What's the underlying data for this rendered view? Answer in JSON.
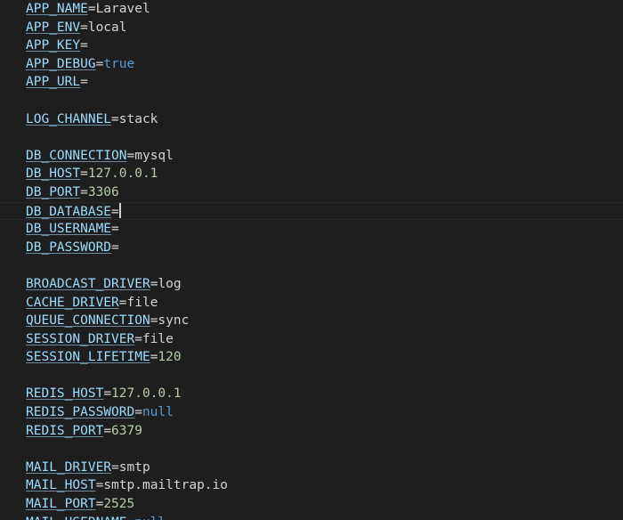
{
  "editor": {
    "colors": {
      "background": "#1e1e1e",
      "key": "#9cdcfe",
      "string": "#d4d4d4",
      "number": "#b5cea8",
      "keyword": "#569cd6"
    },
    "cursor_line": 11,
    "lines": [
      {
        "key": "APP_NAME",
        "value": "Laravel",
        "type": "str"
      },
      {
        "key": "APP_ENV",
        "value": "local",
        "type": "str"
      },
      {
        "key": "APP_KEY",
        "value": "",
        "type": "str"
      },
      {
        "key": "APP_DEBUG",
        "value": "true",
        "type": "kw"
      },
      {
        "key": "APP_URL",
        "value": "",
        "type": "str"
      },
      {
        "blank": true
      },
      {
        "key": "LOG_CHANNEL",
        "value": "stack",
        "type": "str"
      },
      {
        "blank": true
      },
      {
        "key": "DB_CONNECTION",
        "value": "mysql",
        "type": "str"
      },
      {
        "key": "DB_HOST",
        "value": "127.0.0.1",
        "type": "num"
      },
      {
        "key": "DB_PORT",
        "value": "3306",
        "type": "num"
      },
      {
        "key": "DB_DATABASE",
        "value": "",
        "type": "str"
      },
      {
        "key": "DB_USERNAME",
        "value": "",
        "type": "str"
      },
      {
        "key": "DB_PASSWORD",
        "value": "",
        "type": "str"
      },
      {
        "blank": true
      },
      {
        "key": "BROADCAST_DRIVER",
        "value": "log",
        "type": "str"
      },
      {
        "key": "CACHE_DRIVER",
        "value": "file",
        "type": "str"
      },
      {
        "key": "QUEUE_CONNECTION",
        "value": "sync",
        "type": "str"
      },
      {
        "key": "SESSION_DRIVER",
        "value": "file",
        "type": "str"
      },
      {
        "key": "SESSION_LIFETIME",
        "value": "120",
        "type": "num"
      },
      {
        "blank": true
      },
      {
        "key": "REDIS_HOST",
        "value": "127.0.0.1",
        "type": "num"
      },
      {
        "key": "REDIS_PASSWORD",
        "value": "null",
        "type": "kw"
      },
      {
        "key": "REDIS_PORT",
        "value": "6379",
        "type": "num"
      },
      {
        "blank": true
      },
      {
        "key": "MAIL_DRIVER",
        "value": "smtp",
        "type": "str"
      },
      {
        "key": "MAIL_HOST",
        "value": "smtp.mailtrap.io",
        "type": "str"
      },
      {
        "key": "MAIL_PORT",
        "value": "2525",
        "type": "num"
      },
      {
        "key": "MAIL_USERNAME",
        "value": "null",
        "type": "kw"
      }
    ]
  }
}
